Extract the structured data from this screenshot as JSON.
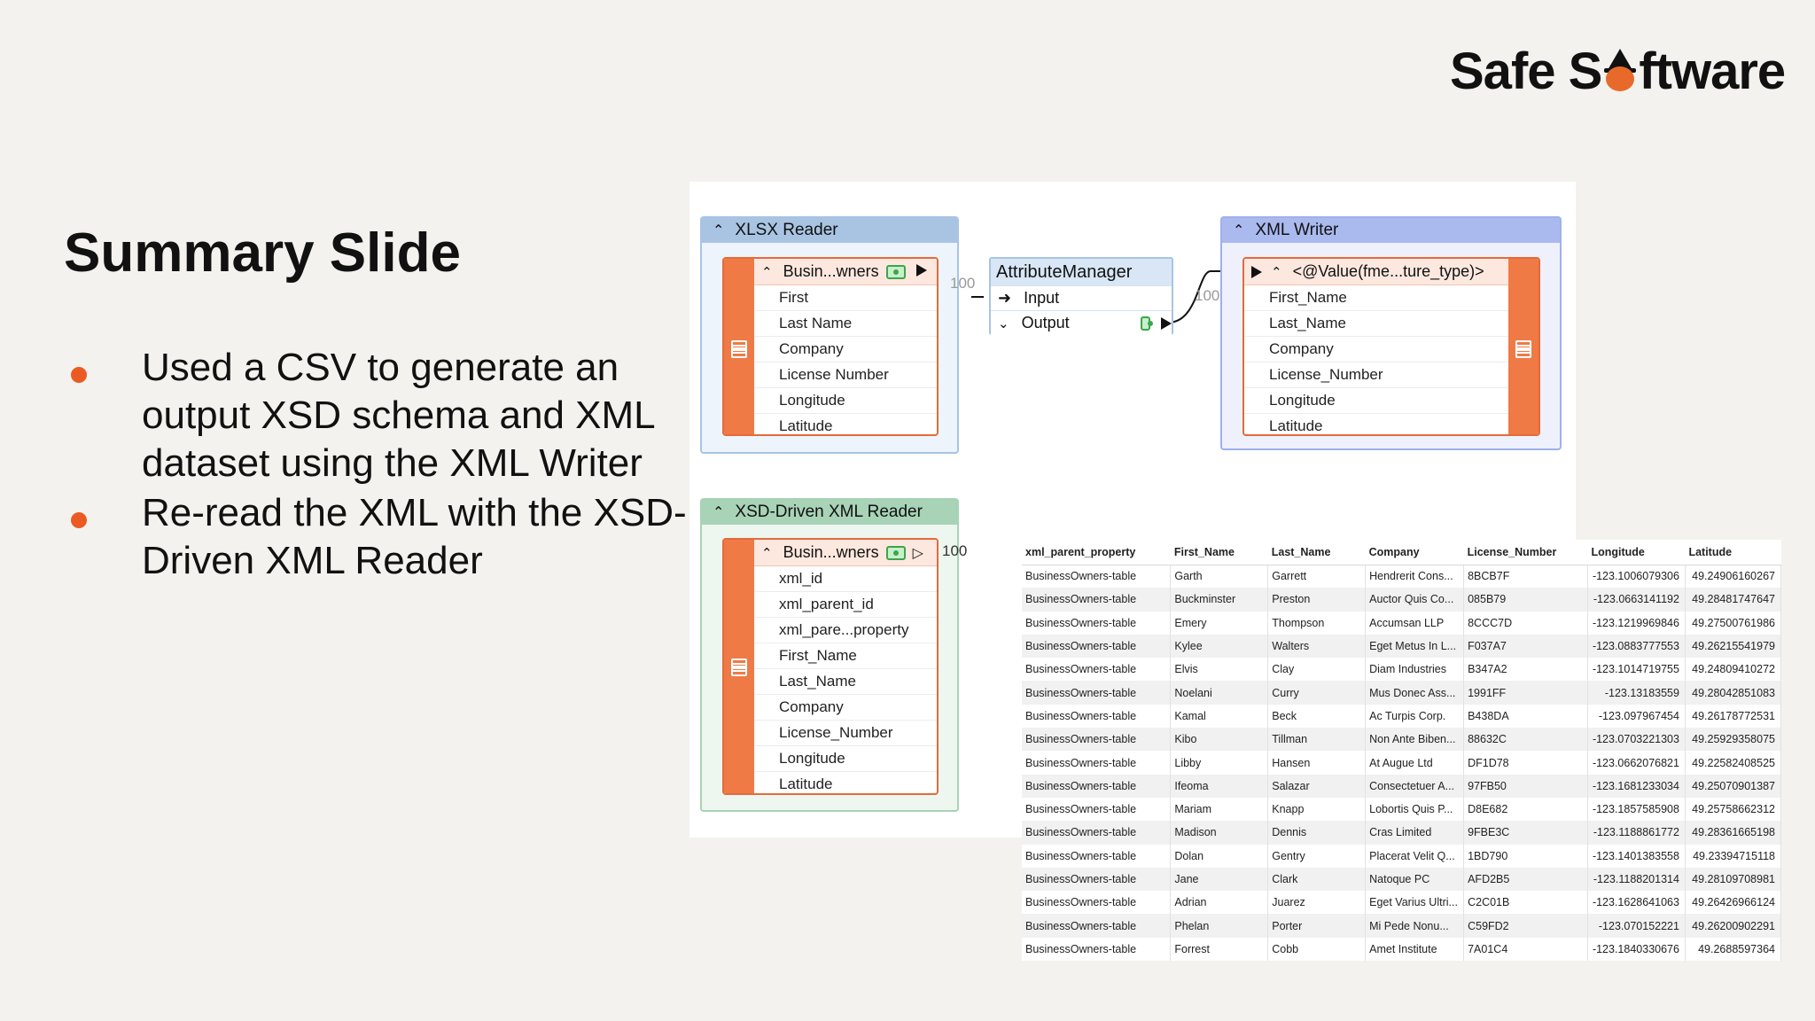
{
  "brand": {
    "logo_part1": "Safe S",
    "logo_part2": "ftware"
  },
  "slide": {
    "title": "Summary Slide",
    "bullets": [
      "Used a CSV to generate an output XSD schema and XML dataset using the XML Writer",
      "Re-read the XML with the XSD-Driven XML Reader"
    ]
  },
  "workspace": {
    "xlsx_reader": {
      "title": "XLSX Reader",
      "feature_type": "Busin...wners",
      "attributes": [
        "First",
        "Last Name",
        "Company",
        "License Number",
        "Longitude",
        "Latitude"
      ],
      "count": "100"
    },
    "attribute_manager": {
      "title": "AttributeManager",
      "input": "Input",
      "output": "Output",
      "count": "100"
    },
    "xml_writer": {
      "title": "XML Writer",
      "feature_type": "<@Value(fme...ture_type)>",
      "attributes": [
        "First_Name",
        "Last_Name",
        "Company",
        "License_Number",
        "Longitude",
        "Latitude"
      ]
    },
    "xsd_reader": {
      "title": "XSD-Driven XML Reader",
      "feature_type": "Busin...wners",
      "count": "100",
      "attributes": [
        "xml_id",
        "xml_parent_id",
        "xml_pare...property",
        "First_Name",
        "Last_Name",
        "Company",
        "License_Number",
        "Longitude",
        "Latitude"
      ]
    },
    "colors": {
      "reader_header": "#a9c4e3",
      "xsd_header": "#a8d3b6",
      "feature_strip": "#f07a45"
    }
  },
  "table": {
    "columns": [
      "xml_parent_property",
      "First_Name",
      "Last_Name",
      "Company",
      "License_Number",
      "Longitude",
      "Latitude"
    ],
    "rows": [
      [
        "BusinessOwners-table",
        "Garth",
        "Garrett",
        "Hendrerit Cons...",
        "8BCB7F",
        "-123.1006079306",
        "49.24906160267"
      ],
      [
        "BusinessOwners-table",
        "Buckminster",
        "Preston",
        "Auctor Quis Co...",
        "085B79",
        "-123.0663141192",
        "49.28481747647"
      ],
      [
        "BusinessOwners-table",
        "Emery",
        "Thompson",
        "Accumsan LLP",
        "8CCC7D",
        "-123.1219969846",
        "49.27500761986"
      ],
      [
        "BusinessOwners-table",
        "Kylee",
        "Walters",
        "Eget Metus In L...",
        "F037A7",
        "-123.0883777553",
        "49.26215541979"
      ],
      [
        "BusinessOwners-table",
        "Elvis",
        "Clay",
        "Diam Industries",
        "B347A2",
        "-123.1014719755",
        "49.24809410272"
      ],
      [
        "BusinessOwners-table",
        "Noelani",
        "Curry",
        "Mus Donec Ass...",
        "1991FF",
        "-123.13183559",
        "49.28042851083"
      ],
      [
        "BusinessOwners-table",
        "Kamal",
        "Beck",
        "Ac Turpis Corp.",
        "B438DA",
        "-123.097967454",
        "49.26178772531"
      ],
      [
        "BusinessOwners-table",
        "Kibo",
        "Tillman",
        "Non Ante Biben...",
        "88632C",
        "-123.0703221303",
        "49.25929358075"
      ],
      [
        "BusinessOwners-table",
        "Libby",
        "Hansen",
        "At Augue Ltd",
        "DF1D78",
        "-123.0662076821",
        "49.22582408525"
      ],
      [
        "BusinessOwners-table",
        "Ifeoma",
        "Salazar",
        "Consectetuer A...",
        "97FB50",
        "-123.1681233034",
        "49.25070901387"
      ],
      [
        "BusinessOwners-table",
        "Mariam",
        "Knapp",
        "Lobortis Quis P...",
        "D8E682",
        "-123.1857585908",
        "49.25758662312"
      ],
      [
        "BusinessOwners-table",
        "Madison",
        "Dennis",
        "Cras Limited",
        "9FBE3C",
        "-123.1188861772",
        "49.28361665198"
      ],
      [
        "BusinessOwners-table",
        "Dolan",
        "Gentry",
        "Placerat Velit Q...",
        "1BD790",
        "-123.1401383558",
        "49.23394715118"
      ],
      [
        "BusinessOwners-table",
        "Jane",
        "Clark",
        "Natoque PC",
        "AFD2B5",
        "-123.1188201314",
        "49.28109708981"
      ],
      [
        "BusinessOwners-table",
        "Adrian",
        "Juarez",
        "Eget Varius Ultri...",
        "C2C01B",
        "-123.1628641063",
        "49.26426966124"
      ],
      [
        "BusinessOwners-table",
        "Phelan",
        "Porter",
        "Mi Pede Nonu...",
        "C59FD2",
        "-123.070152221",
        "49.26200902291"
      ],
      [
        "BusinessOwners-table",
        "Forrest",
        "Cobb",
        "Amet Institute",
        "7A01C4",
        "-123.1840330676",
        "49.2688597364"
      ]
    ]
  }
}
